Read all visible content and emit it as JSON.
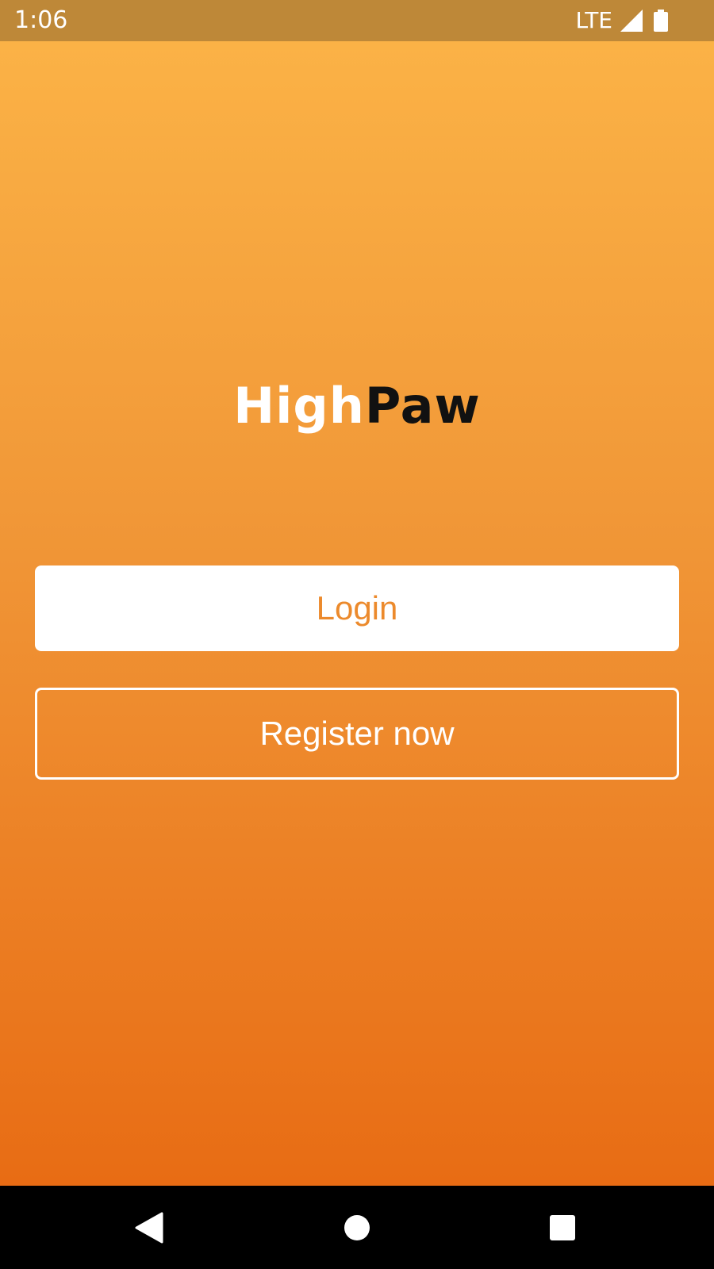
{
  "status_bar": {
    "time": "1:06",
    "network": "LTE",
    "icons": [
      "signal-icon",
      "battery-icon"
    ]
  },
  "logo": {
    "part1": "High",
    "part2": "Paw"
  },
  "buttons": {
    "login_label": "Login",
    "register_label": "Register now"
  },
  "nav_bar": {
    "icons": [
      "back-icon",
      "home-icon",
      "recents-icon"
    ]
  },
  "colors": {
    "status_bar": "#be8838",
    "gradient_top": "#fbb246",
    "gradient_bottom": "#e86c14",
    "accent": "#ec8a2c",
    "white": "#ffffff",
    "black": "#000000"
  }
}
